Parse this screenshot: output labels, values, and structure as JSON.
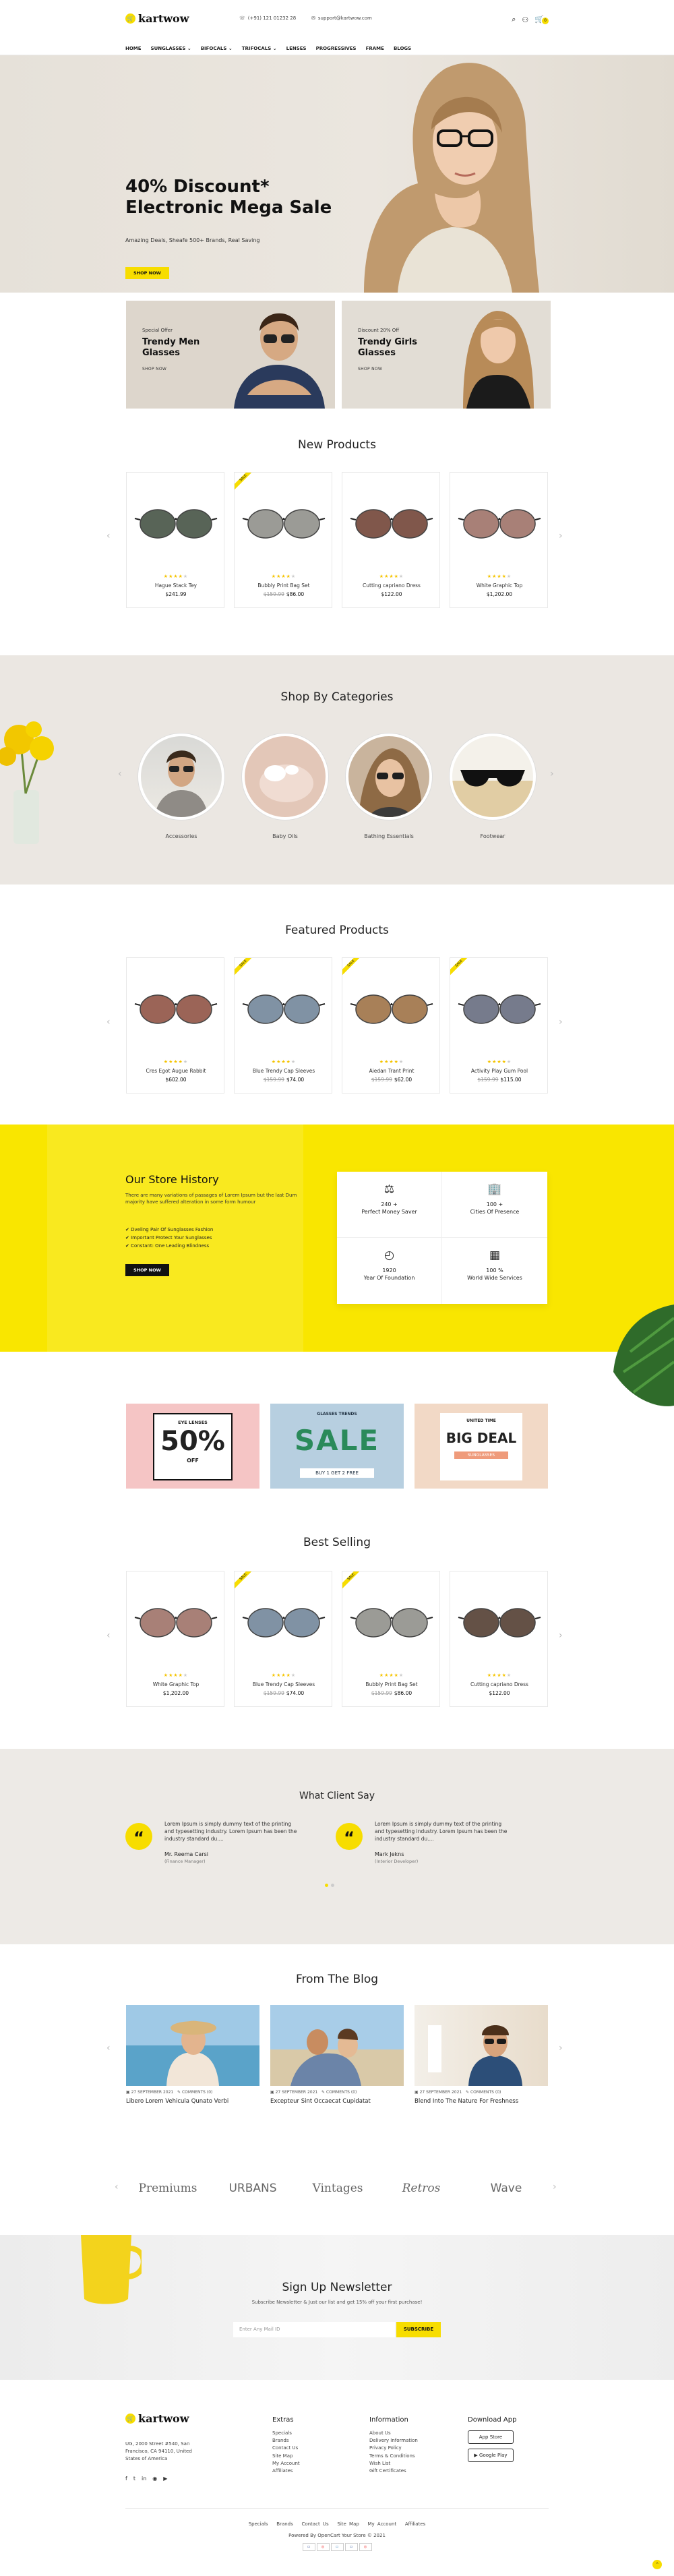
{
  "header": {
    "logo": "kartwow",
    "phone": "(+91) 121 01232 28",
    "email": "support@kartwow.com",
    "cart_count": "0",
    "nav": [
      "HOME",
      "SUNGLASSES",
      "BIFOCALS",
      "TRIFOCALS",
      "LENSES",
      "PROGRESSIVES",
      "FRAME",
      "BLOGS"
    ]
  },
  "hero": {
    "line1": "40% Discount*",
    "line2": "Electronic Mega Sale",
    "sub": "Amazing Deals, Sheafe 500+ Brands, Real Saving",
    "button": "SHOP NOW"
  },
  "banners": [
    {
      "small": "Special Offer",
      "title1": "Trendy Men",
      "title2": "Glasses",
      "link": "SHOP NOW"
    },
    {
      "small": "Discount 20% Off",
      "title1": "Trendy Girls",
      "title2": "Glasses",
      "link": "SHOP NOW"
    }
  ],
  "new_products": {
    "title": "New Products",
    "items": [
      {
        "name": "Hague Stack Tey",
        "old": "",
        "price": "$241.99",
        "rating": 4,
        "badge": ""
      },
      {
        "name": "Bubbly Print Bag Set",
        "old": "$159.99",
        "price": "$86.00",
        "rating": 4,
        "badge": "SALE"
      },
      {
        "name": "Cutting capriano Dress",
        "old": "",
        "price": "$122.00",
        "rating": 4,
        "badge": ""
      },
      {
        "name": "White Graphic Top",
        "old": "",
        "price": "$1,202.00",
        "rating": 4,
        "badge": ""
      }
    ]
  },
  "categories": {
    "title": "Shop By Categories",
    "items": [
      "Accessories",
      "Baby Oils",
      "Bathing Essentials",
      "Footwear"
    ]
  },
  "featured": {
    "title": "Featured Products",
    "items": [
      {
        "name": "Cres Egot Augue Rabbit",
        "old": "",
        "price": "$602.00",
        "rating": 4,
        "badge": ""
      },
      {
        "name": "Blue Trendy Cap Sleeves",
        "old": "$159.99",
        "price": "$74.00",
        "rating": 4,
        "badge": "SALE"
      },
      {
        "name": "Aiedan Trant Print",
        "old": "$159.99",
        "price": "$62.00",
        "rating": 4,
        "badge": "SALE"
      },
      {
        "name": "Activity Play Gum Pool",
        "old": "$159.99",
        "price": "$115.00",
        "rating": 4,
        "badge": "SALE"
      }
    ]
  },
  "history": {
    "title": "Our Store History",
    "text": "There are many variations of passages of Lorem Ipsum but the last Dum majority have suffered alteration in some form humour",
    "list": [
      "Dveling Pair Of Sunglasses Fashion",
      "Important Protect Your Sunglasses",
      "Constant: One Leading Blindness"
    ],
    "button": "SHOP NOW",
    "stats": [
      {
        "icon": "money-icon",
        "value": "240 +",
        "label": "Perfect Money Saver"
      },
      {
        "icon": "city-icon",
        "value": "100 +",
        "label": "Cities Of Presence"
      },
      {
        "icon": "clock-icon",
        "value": "1920",
        "label": "Year Of Foundation"
      },
      {
        "icon": "service-icon",
        "value": "100 %",
        "label": "World Wide Services"
      }
    ]
  },
  "promos": [
    {
      "top": "EYE LENSES",
      "big": "50%",
      "sub": "OFF"
    },
    {
      "top": "GLASSES TRENDS",
      "big": "SALE",
      "sub": "BUY 1 GET 2 FREE"
    },
    {
      "top": "UNITED TIME",
      "big": "BIG DEAL",
      "sub": "SUNGLASSES"
    }
  ],
  "best_selling": {
    "title": "Best Selling",
    "items": [
      {
        "name": "White Graphic Top",
        "old": "",
        "price": "$1,202.00",
        "rating": 4,
        "badge": ""
      },
      {
        "name": "Blue Trendy Cap Sleeves",
        "old": "$159.99",
        "price": "$74.00",
        "rating": 4,
        "badge": "SALE"
      },
      {
        "name": "Bubbly Print Bag Set",
        "old": "$159.99",
        "price": "$86.00",
        "rating": 4,
        "badge": "SALE"
      },
      {
        "name": "Cutting capriano Dress",
        "old": "",
        "price": "$122.00",
        "rating": 4,
        "badge": ""
      }
    ]
  },
  "testimonials": {
    "title": "What Client Say",
    "items": [
      {
        "text": "Lorem Ipsum is simply dummy text of the printing and typesetting industry. Lorem Ipsum has been the industry standard du....",
        "name": "Mr. Reema Carsi",
        "role": "(Finance Manager)"
      },
      {
        "text": "Lorem Ipsum is simply dummy text of the printing and typesetting industry. Lorem Ipsum has been the industry standard du....",
        "name": "Mark Jekns",
        "role": "(Interior Developer)"
      }
    ]
  },
  "blog": {
    "title": "From The Blog",
    "items": [
      {
        "date": "27 SEPTEMBER 2021",
        "comments": "COMMENTS (0)",
        "title": "Libero Lorem Vehicula Qunato Verbi"
      },
      {
        "date": "27 SEPTEMBER 2021",
        "comments": "COMMENTS (0)",
        "title": "Excepteur Sint Occaecat Cupidatat"
      },
      {
        "date": "27 SEPTEMBER 2021",
        "comments": "COMMENTS (0)",
        "title": "Blend Into The Nature For Freshness"
      }
    ]
  },
  "brands": [
    "Premiums",
    "URBANS",
    "Vintages",
    "Retros",
    "Wave"
  ],
  "newsletter": {
    "title": "Sign Up Newsletter",
    "text": "Subscribe Newsletter & Just our list and get 15% off your first purchase!",
    "placeholder": "Enter Any Mail ID",
    "button": "SUBSCRIBE"
  },
  "footer": {
    "logo": "kartwow",
    "address": "UG, 2000 Street #540, San Francisco, CA 94110, United States of America",
    "extras_title": "Extras",
    "extras": [
      "Specials",
      "Brands",
      "Contact Us",
      "Site Map",
      "My Account",
      "Affiliates"
    ],
    "info_title": "Information",
    "info": [
      "About Us",
      "Delivery Information",
      "Privacy Policy",
      "Terms & Conditions",
      "Wish List",
      "Gift Certificates"
    ],
    "app_title": "Download App",
    "app_store": "App Store",
    "google_play": "Google Play",
    "bottom_links": [
      "Specials",
      "Brands",
      "Contact Us",
      "Site Map",
      "My Account",
      "Affiliates"
    ],
    "powered": "Powered By OpenCart Your Store © 2021"
  },
  "colors": {
    "accent": "#f7dd00"
  }
}
